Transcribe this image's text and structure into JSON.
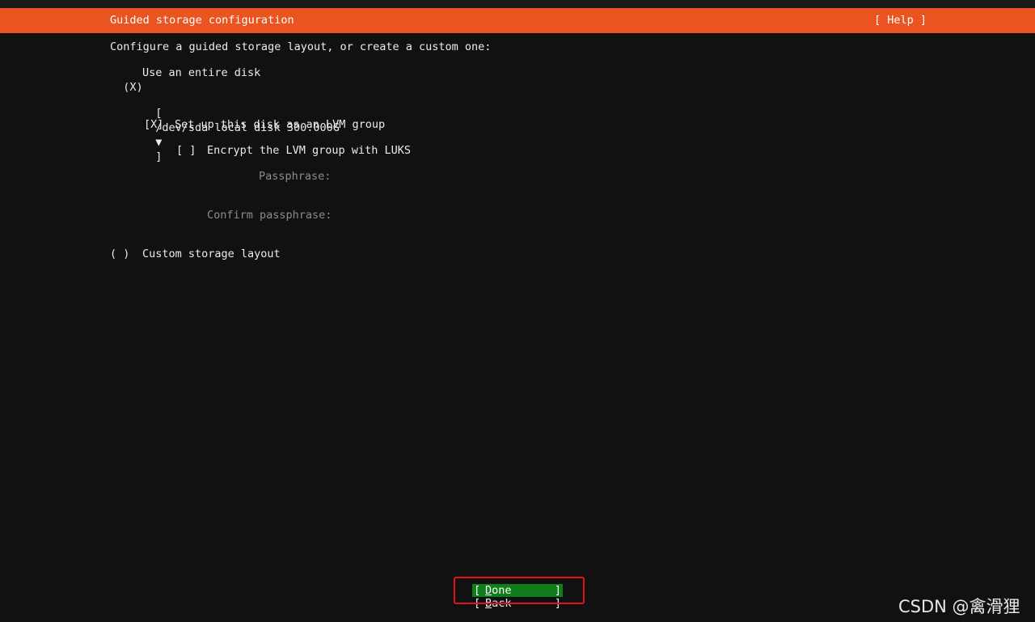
{
  "header": {
    "title": "Guided storage configuration",
    "help_label": "[ Help ]"
  },
  "intro": "Configure a guided storage layout, or create a custom one:",
  "entire_disk": {
    "radio": "(X)",
    "label": "Use an entire disk"
  },
  "disk_select": {
    "open_bracket": "[",
    "value": "/dev/sda local disk 300.000G",
    "arrow": "▼",
    "close_bracket": "]"
  },
  "lvm": {
    "checkbox": "[X]",
    "label": "Set up this disk as an LVM group"
  },
  "luks": {
    "checkbox": "[ ]",
    "label": "Encrypt the LVM group with LUKS"
  },
  "passphrase": {
    "label": "Passphrase:",
    "value": ""
  },
  "confirm_passphrase": {
    "label": "Confirm passphrase:",
    "value": ""
  },
  "custom_layout": {
    "radio": "( )",
    "label": "Custom storage layout"
  },
  "buttons": {
    "done": {
      "open_bracket": "[",
      "hotkey": "D",
      "rest": "one",
      "close_bracket": "]"
    },
    "back": {
      "open_bracket": "[",
      "hotkey": "B",
      "rest": "ack",
      "close_bracket": "]"
    }
  },
  "watermark": "CSDN @禽滑狸",
  "colors": {
    "header_bg": "#e95420",
    "background": "#111111",
    "focused_button": "#0f7d1a",
    "highlight_box": "#e0121e"
  }
}
